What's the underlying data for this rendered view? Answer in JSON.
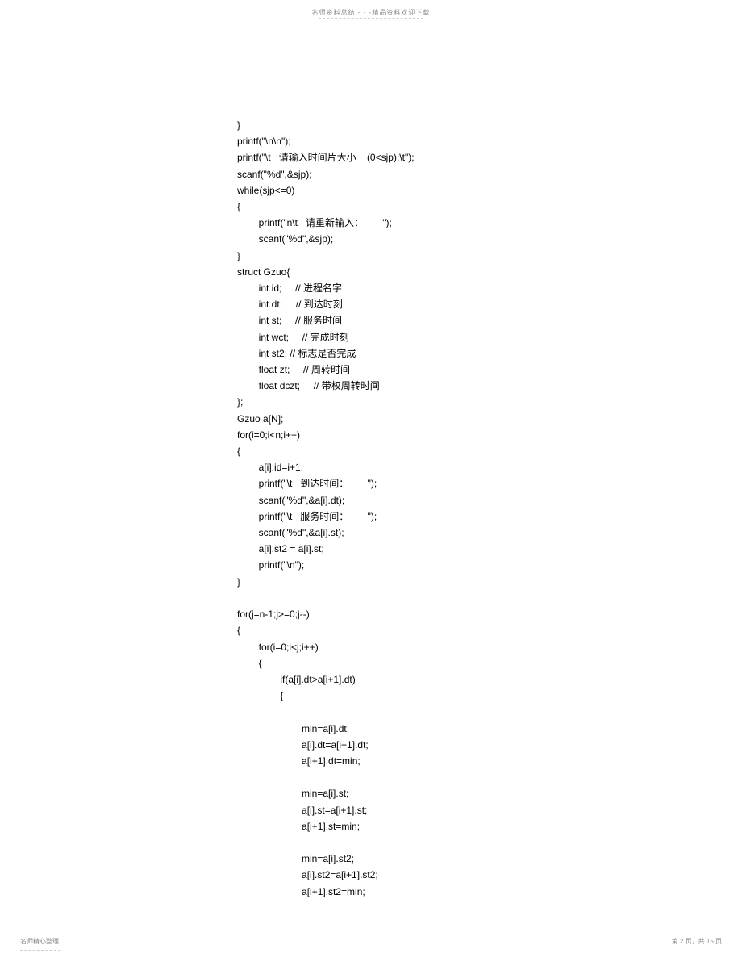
{
  "header": "名师资料总结 - - -精品资料欢迎下载",
  "footer_left": "名师精心整理",
  "footer_right": "第 2 页，共 15 页",
  "code": "}\nprintf(\"\\n\\n\");\nprintf(\"\\t   请输入时间片大小    (0<sjp):\\t\");\nscanf(\"%d\",&sjp);\nwhile(sjp<=0)\n{\n        printf(\"n\\t   请重新输入：       \");\n        scanf(\"%d\",&sjp);\n}\nstruct Gzuo{\n        int id;     // 进程名字\n        int dt;     // 到达时刻\n        int st;     // 服务时间\n        int wct;     // 完成时刻\n        int st2; // 标志是否完成\n        float zt;     // 周转时间\n        float dczt;     // 带权周转时间\n};\nGzuo a[N];\nfor(i=0;i<n;i++)\n{\n        a[i].id=i+1;\n        printf(\"\\t   到达时间：       \");\n        scanf(\"%d\",&a[i].dt);\n        printf(\"\\t   服务时间：       \");\n        scanf(\"%d\",&a[i].st);\n        a[i].st2 = a[i].st;\n        printf(\"\\n\");\n}\n\nfor(j=n-1;j>=0;j--)\n{\n        for(i=0;i<j;i++)\n        {\n                if(a[i].dt>a[i+1].dt)\n                {\n\n                        min=a[i].dt;\n                        a[i].dt=a[i+1].dt;\n                        a[i+1].dt=min;\n\n                        min=a[i].st;\n                        a[i].st=a[i+1].st;\n                        a[i+1].st=min;\n\n                        min=a[i].st2;\n                        a[i].st2=a[i+1].st2;\n                        a[i+1].st2=min;"
}
